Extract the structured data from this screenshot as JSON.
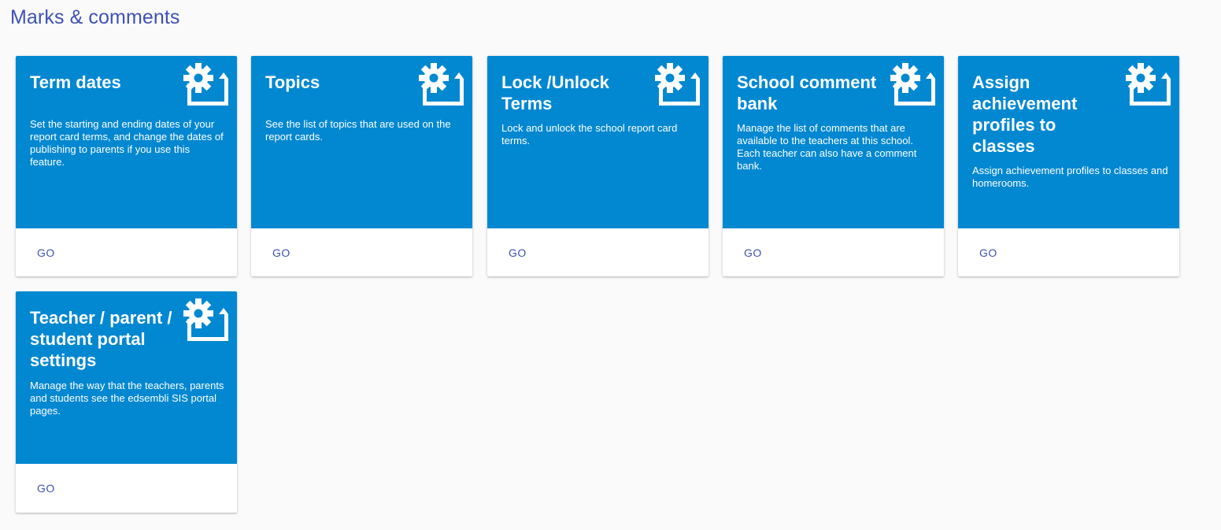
{
  "page": {
    "title": "Marks & comments"
  },
  "colors": {
    "title": "#3f51b5",
    "card_header": "#0288d1",
    "button_text": "#3f51b5",
    "background": "#fafafa"
  },
  "cards": [
    {
      "title": "Term dates",
      "description": "Set the starting and ending dates of your report card terms, and change the dates of publishing to parents if you use this feature.",
      "button": "GO",
      "icon": "settings-gear-folder-icon"
    },
    {
      "title": "Topics",
      "description": "See the list of topics that are used on the report cards.",
      "button": "GO",
      "icon": "settings-gear-folder-icon"
    },
    {
      "title": "Lock /Unlock Terms",
      "description": "Lock and unlock the school report card terms.",
      "button": "GO",
      "icon": "settings-gear-folder-icon"
    },
    {
      "title": "School comment bank",
      "description": "Manage the list of comments that are available to the teachers at this school. Each teacher can also have a comment bank.",
      "button": "GO",
      "icon": "settings-gear-folder-icon"
    },
    {
      "title": "Assign achievement profiles to classes",
      "description": "Assign achievement profiles to classes and homerooms.",
      "button": "GO",
      "icon": "settings-gear-folder-icon"
    },
    {
      "title": "Teacher / parent / student portal settings",
      "description": "Manage the way that the teachers, parents and students see the edsembli SIS portal pages.",
      "button": "GO",
      "icon": "settings-gear-folder-icon"
    }
  ]
}
